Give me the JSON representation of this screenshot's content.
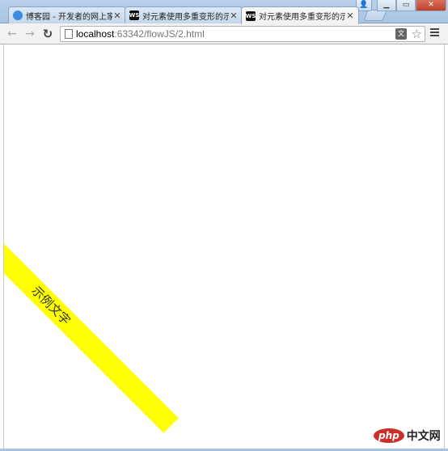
{
  "tabs": [
    {
      "title": "博客园 - 开发者的网上家园",
      "favicon": "blog-icon",
      "active": false
    },
    {
      "title": "对元素使用多重变形的示例",
      "favicon": "ws-icon",
      "active": false
    },
    {
      "title": "对元素使用多重变形的示例",
      "favicon": "ws-icon",
      "active": true
    }
  ],
  "favicon_labels": {
    "ws": "WS"
  },
  "address": {
    "host": "localhost",
    "rest": ":63342/flowJS/2.html"
  },
  "page": {
    "demo_text": "示例文字",
    "box_color": "#ffff00"
  },
  "watermark": {
    "logo": "php",
    "site": "中文网"
  }
}
